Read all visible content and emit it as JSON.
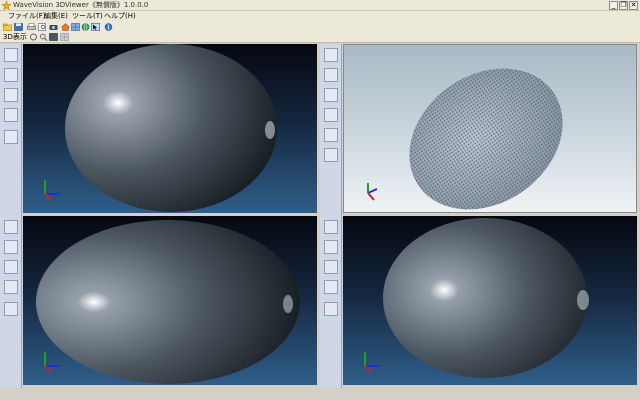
{
  "window": {
    "title": "WaveVision 3DViewer《無償版》1.0.0.0",
    "controls": [
      "_",
      "❐",
      "✕"
    ]
  },
  "menu": [
    {
      "label": "ファイル(F)"
    },
    {
      "label": "編集(E)"
    },
    {
      "label": "ツール(T)"
    },
    {
      "label": "ヘルプ(H)"
    }
  ],
  "toolbar2": {
    "label": "3D表示"
  },
  "viewports": [
    {
      "name": "top-left",
      "render": "shaded"
    },
    {
      "name": "top-right",
      "render": "point-cloud"
    },
    {
      "name": "bottom-left",
      "render": "shaded"
    },
    {
      "name": "bottom-right",
      "render": "shaded"
    }
  ],
  "colors": {
    "dark_bg_top": "#050810",
    "dark_bg_bottom": "#2f5e8a",
    "light_bg_top": "#a9b9c4",
    "light_bg_bottom": "#f0f3f5",
    "sphere": "#5c6672",
    "axis_x": "#d02020",
    "axis_y": "#20a020",
    "axis_z": "#2030d0"
  }
}
